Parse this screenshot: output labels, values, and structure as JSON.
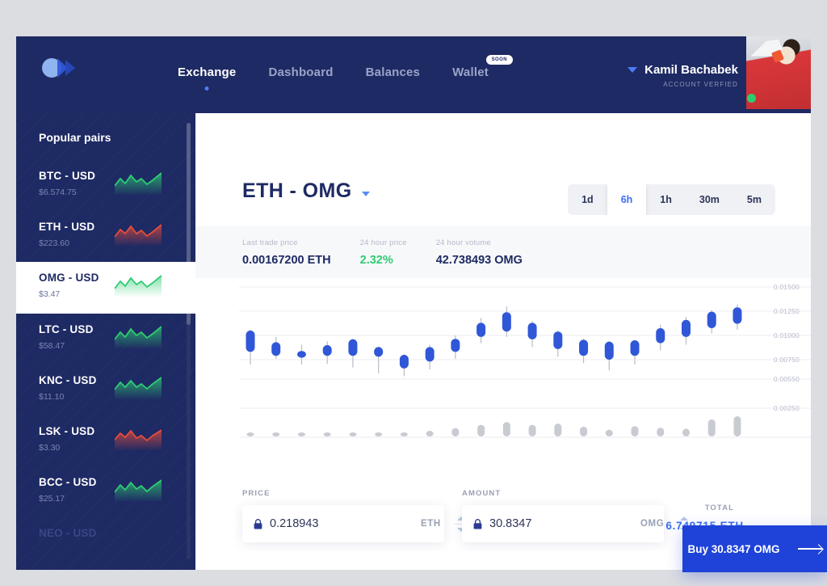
{
  "brand": {
    "logo_icon": "logo-circle-chevron"
  },
  "nav": {
    "items": [
      {
        "label": "Exchange",
        "active": true
      },
      {
        "label": "Dashboard",
        "active": false
      },
      {
        "label": "Balances",
        "active": false
      },
      {
        "label": "Wallet",
        "active": false,
        "badge": "SOON"
      }
    ]
  },
  "account": {
    "name": "Kamil Bachabek",
    "status": "ACCOUNT VERFIED",
    "caret_icon": "chevron-down-icon",
    "avatar_alt": "user-avatar",
    "online": true
  },
  "sidebar": {
    "title": "Popular pairs",
    "pairs": [
      {
        "name": "BTC - USD",
        "price": "$6.574.75",
        "trend": "up",
        "active": false
      },
      {
        "name": "ETH - USD",
        "price": "$223.60",
        "trend": "down",
        "active": false
      },
      {
        "name": "OMG - USD",
        "price": "$3.47",
        "trend": "up",
        "active": true
      },
      {
        "name": "LTC - USD",
        "price": "$58.47",
        "trend": "up",
        "active": false
      },
      {
        "name": "KNC - USD",
        "price": "$11.10",
        "trend": "up",
        "active": false
      },
      {
        "name": "LSK - USD",
        "price": "$3.30",
        "trend": "down",
        "active": false
      },
      {
        "name": "BCC - USD",
        "price": "$25.17",
        "trend": "up",
        "active": false
      },
      {
        "name": "NEO - USD",
        "price": "",
        "trend": "up",
        "active": false
      }
    ]
  },
  "market": {
    "pair_title": "ETH - OMG",
    "pair_caret_icon": "chevron-down-icon",
    "timeframes": [
      {
        "label": "1d",
        "active": false
      },
      {
        "label": "6h",
        "active": true
      },
      {
        "label": "1h",
        "active": false
      },
      {
        "label": "30m",
        "active": false
      },
      {
        "label": "5m",
        "active": false
      }
    ],
    "stats": [
      {
        "label": "Last trade price",
        "value": "0.00167200 ETH",
        "positive": false
      },
      {
        "label": "24 hour price",
        "value": "2.32%",
        "positive": true
      },
      {
        "label": "24 hour volume",
        "value": "42.738493 OMG",
        "positive": false
      }
    ]
  },
  "order": {
    "price_label": "PRICE",
    "price_value": "0.218943",
    "price_unit": "ETH",
    "amount_label": "AMOUNT",
    "amount_value": "30.8347",
    "amount_unit": "OMG",
    "total_label": "TOTAL",
    "total_value": "6.749715 ETH",
    "buy_label": "Buy 30.8347 OMG",
    "lock_icon": "lock-icon",
    "stepper_icon": "stepper-up-down-icon",
    "arrow_icon": "arrow-right-icon"
  },
  "colors": {
    "navy": "#1e2a63",
    "accent_blue": "#3b6ef0",
    "candle_blue": "#2f57d8",
    "buy_blue": "#1f43d8",
    "green": "#2ecc71",
    "red": "#e74c3c",
    "volume_gray": "#c9cbd2"
  },
  "chart_data": {
    "type": "candlestick",
    "title": "ETH - OMG",
    "xlabel": "",
    "ylabel": "",
    "ylim": [
      0.0025,
      0.015
    ],
    "grid": true,
    "ytick_labels": [
      "0.01500",
      "0.01250",
      "0.01000",
      "0.00750",
      "0.00550",
      "0.00250"
    ],
    "ytick_values": [
      0.015,
      0.0125,
      0.01,
      0.0075,
      0.0055,
      0.0025
    ],
    "candles": [
      {
        "open": 0.0105,
        "high": 0.0106,
        "low": 0.007,
        "close": 0.0083,
        "volume": 0.1
      },
      {
        "open": 0.0093,
        "high": 0.00985,
        "low": 0.0076,
        "close": 0.0079,
        "volume": 0.12
      },
      {
        "open": 0.0084,
        "high": 0.00905,
        "low": 0.007,
        "close": 0.0077,
        "volume": 0.1
      },
      {
        "open": 0.009,
        "high": 0.0094,
        "low": 0.00705,
        "close": 0.0079,
        "volume": 0.11
      },
      {
        "open": 0.0096,
        "high": 0.00965,
        "low": 0.0067,
        "close": 0.0079,
        "volume": 0.15
      },
      {
        "open": 0.0088,
        "high": 0.00885,
        "low": 0.0061,
        "close": 0.0078,
        "volume": 0.06
      },
      {
        "open": 0.008,
        "high": 0.00805,
        "low": 0.0058,
        "close": 0.0066,
        "volume": 0.13
      },
      {
        "open": 0.0088,
        "high": 0.00905,
        "low": 0.0065,
        "close": 0.0073,
        "volume": 0.22
      },
      {
        "open": 0.00965,
        "high": 0.01,
        "low": 0.0076,
        "close": 0.0083,
        "volume": 0.33
      },
      {
        "open": 0.0113,
        "high": 0.0118,
        "low": 0.0092,
        "close": 0.00985,
        "volume": 0.45
      },
      {
        "open": 0.0124,
        "high": 0.013,
        "low": 0.00985,
        "close": 0.0104,
        "volume": 0.56
      },
      {
        "open": 0.0113,
        "high": 0.0115,
        "low": 0.0088,
        "close": 0.0096,
        "volume": 0.45
      },
      {
        "open": 0.0104,
        "high": 0.0105,
        "low": 0.0078,
        "close": 0.0086,
        "volume": 0.5
      },
      {
        "open": 0.00955,
        "high": 0.00965,
        "low": 0.00715,
        "close": 0.0079,
        "volume": 0.38
      },
      {
        "open": 0.00935,
        "high": 0.00945,
        "low": 0.0064,
        "close": 0.0075,
        "volume": 0.26
      },
      {
        "open": 0.0095,
        "high": 0.00955,
        "low": 0.007,
        "close": 0.0079,
        "volume": 0.4
      },
      {
        "open": 0.01075,
        "high": 0.0111,
        "low": 0.00845,
        "close": 0.0092,
        "volume": 0.34
      },
      {
        "open": 0.0116,
        "high": 0.0119,
        "low": 0.00905,
        "close": 0.00985,
        "volume": 0.3
      },
      {
        "open": 0.01245,
        "high": 0.0126,
        "low": 0.0102,
        "close": 0.01075,
        "volume": 0.66
      },
      {
        "open": 0.0129,
        "high": 0.0132,
        "low": 0.0106,
        "close": 0.0112,
        "volume": 0.78
      }
    ]
  }
}
